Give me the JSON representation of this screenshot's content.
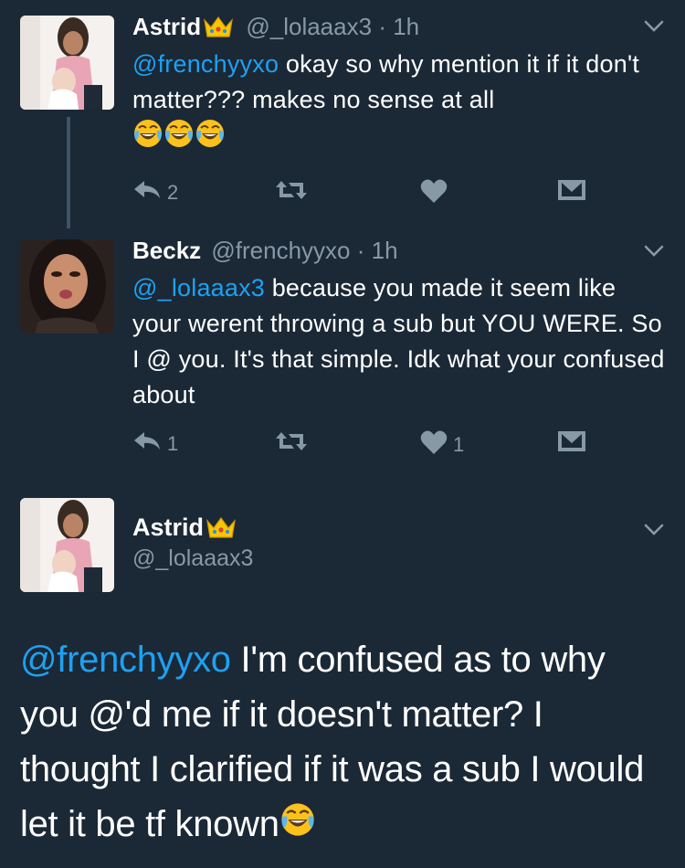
{
  "tweets": [
    {
      "name": "Astrid",
      "handle": "@_lolaaax3",
      "dot": "·",
      "time": "1h",
      "mention": "@frenchyyxo",
      "text": " okay so why mention it if it don't matter??? makes no sense at all",
      "reply_count": "2",
      "retweet_count": "",
      "like_count": ""
    },
    {
      "name": "Beckz",
      "handle": "@frenchyyxo",
      "dot": "·",
      "time": "1h",
      "mention": "@_lolaaax3",
      "text": " because you made it seem like your werent throwing a sub but YOU WERE. So I @ you. It's that simple. Idk what your confused about",
      "reply_count": "1",
      "retweet_count": "",
      "like_count": "1"
    }
  ],
  "main_tweet": {
    "name": "Astrid",
    "handle": "@_lolaaax3",
    "mention": "@frenchyyxo",
    "text": " I'm confused as to why you @'d me if it doesn't matter? I thought I clarified if it was a sub I would let it be tf known"
  },
  "icons": {
    "crown": "crown-emoji",
    "laugh": "face-with-tears-of-joy-emoji",
    "reply": "reply-icon",
    "retweet": "retweet-icon",
    "like": "heart-icon",
    "dm": "envelope-icon",
    "caret": "chevron-down-icon"
  },
  "colors": {
    "background": "#1b2836",
    "link": "#1da1f2",
    "muted": "#8899a6"
  }
}
